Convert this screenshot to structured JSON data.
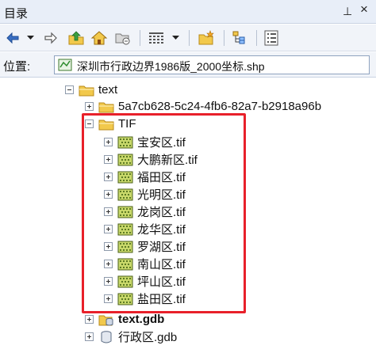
{
  "window": {
    "title": "目录",
    "pin_glyph": "⊥",
    "close_glyph": "×"
  },
  "toolbar": {
    "icons": [
      "back-arrow-icon",
      "dropdown-arrow-icon",
      "forward-arrow-icon",
      "up-folder-icon",
      "home-icon",
      "connect-folder-icon",
      "view-grid-icon",
      "dropdown-arrow-icon",
      "new-item-icon",
      "tree-icon",
      "options-icon"
    ]
  },
  "location": {
    "label": "位置:",
    "value": "深圳市行政边界1986版_2000坐标.shp"
  },
  "tree": {
    "items": [
      {
        "label": "text",
        "type": "folder",
        "expanded": true,
        "bold": false
      },
      {
        "label": "5a7cb628-5c24-4fb6-82a7-b2918a96b",
        "type": "folder",
        "expanded": false,
        "bold": false
      },
      {
        "label": "TIF",
        "type": "folder",
        "expanded": true,
        "bold": false
      },
      {
        "label": "宝安区.tif",
        "type": "raster",
        "expanded": false,
        "bold": false
      },
      {
        "label": "大鹏新区.tif",
        "type": "raster",
        "expanded": false,
        "bold": false
      },
      {
        "label": "福田区.tif",
        "type": "raster",
        "expanded": false,
        "bold": false
      },
      {
        "label": "光明区.tif",
        "type": "raster",
        "expanded": false,
        "bold": false
      },
      {
        "label": "龙岗区.tif",
        "type": "raster",
        "expanded": false,
        "bold": false
      },
      {
        "label": "龙华区.tif",
        "type": "raster",
        "expanded": false,
        "bold": false
      },
      {
        "label": "罗湖区.tif",
        "type": "raster",
        "expanded": false,
        "bold": false
      },
      {
        "label": "南山区.tif",
        "type": "raster",
        "expanded": false,
        "bold": false
      },
      {
        "label": "坪山区.tif",
        "type": "raster",
        "expanded": false,
        "bold": false
      },
      {
        "label": "盐田区.tif",
        "type": "raster",
        "expanded": false,
        "bold": false
      },
      {
        "label": "text.gdb",
        "type": "gdb",
        "expanded": false,
        "bold": true
      },
      {
        "label": "行政区.gdb",
        "type": "gdb",
        "expanded": false,
        "bold": false
      }
    ]
  },
  "colors": {
    "highlight_border": "#e8202a",
    "folder": "#f2c94c",
    "raster": "#6e8f3a"
  }
}
